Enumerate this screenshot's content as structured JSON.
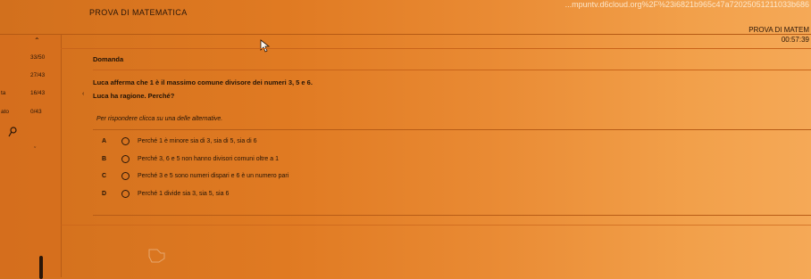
{
  "browser": {
    "url": "...mpuntv.d6cloud.org%2F%23i6821b965c47a72025051211033b686"
  },
  "header": {
    "title": "PROVA DI MATEMATICA",
    "right_title": "PROVA DI MATEM",
    "timer": "00:57:39"
  },
  "sidebar": {
    "rows": [
      {
        "label": "",
        "value": "33/50"
      },
      {
        "label": "",
        "value": "27/43"
      },
      {
        "label": "ta",
        "value": "16/43"
      },
      {
        "label": "ato",
        "value": "0/43"
      }
    ],
    "icons": {
      "up": "chevron-up-icon",
      "search": "search-icon",
      "down": "chevron-down-icon"
    }
  },
  "question": {
    "heading": "Domanda",
    "text": "Luca afferma che 1 è il massimo comune divisore dei numeri 3, 5 e 6.",
    "prompt": "Luca ha ragione. Perché?",
    "instruction": "Per rispondere clicca su una delle alternative."
  },
  "options": [
    {
      "letter": "A",
      "text": "Perché 1 è minore sia di 3, sia di 5, sia di 6"
    },
    {
      "letter": "B",
      "text": "Perché 3, 6 e 5 non hanno divisori comuni oltre a 1"
    },
    {
      "letter": "C",
      "text": "Perché 3 e 5 sono numeri dispari e 6 è un numero pari"
    },
    {
      "letter": "D",
      "text": "Perché 1 divide sia 3, sia 5, sia 6"
    }
  ],
  "colors": {
    "accent": "#e07a22",
    "line": "#b85c16",
    "text": "#241406"
  }
}
